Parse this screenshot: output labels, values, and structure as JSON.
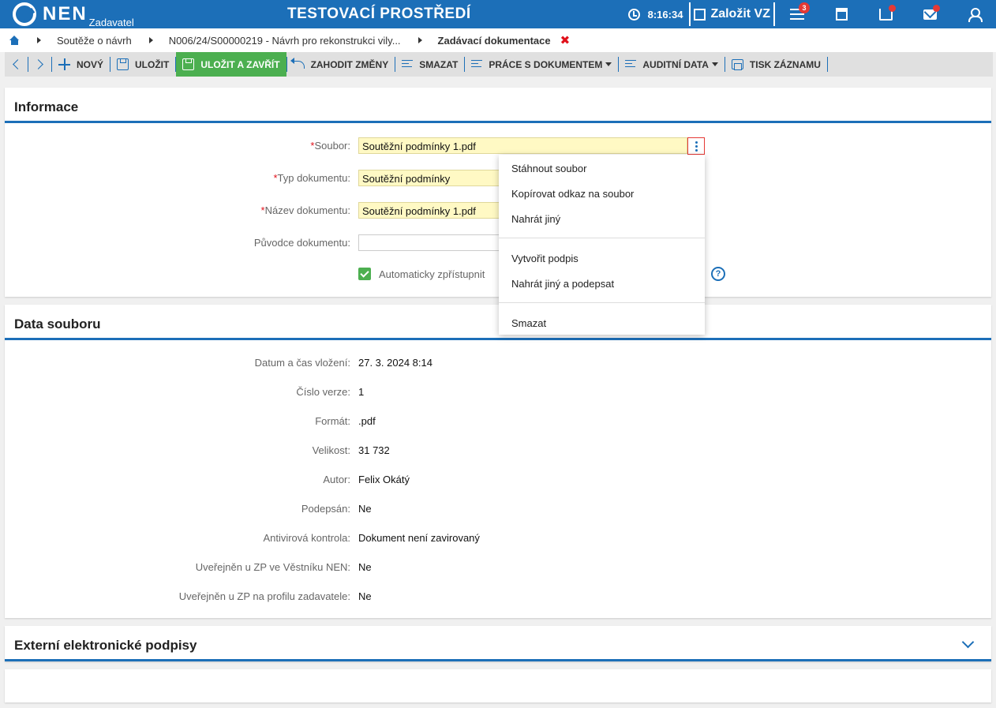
{
  "header": {
    "logo_text": "NEN",
    "logo_sub": "Zadavatel",
    "env_title": "TESTOVACÍ PROSTŘEDÍ",
    "time": "8:16:34",
    "create_label": "Založit VZ",
    "menu_badge": "3"
  },
  "breadcrumb": {
    "items": [
      "Soutěže o návrh",
      "N006/24/S00000219 - Návrh pro rekonstrukci vily..."
    ],
    "current": "Zadávací dokumentace",
    "close": "✖"
  },
  "toolbar": {
    "new": "NOVÝ",
    "save": "ULOŽIT",
    "save_close": "ULOŽIT A ZAVŘÍT",
    "discard": "ZAHODIT ZMĚNY",
    "delete": "SMAZAT",
    "doc_work": "PRÁCE S DOKUMENTEM",
    "audit": "AUDITNÍ DATA",
    "print": "TISK ZÁZNAMU"
  },
  "info": {
    "title": "Informace",
    "required_mark": "*",
    "file_label": "Soubor:",
    "file_value": "Soutěžní podmínky 1.pdf",
    "type_label": "Typ dokumentu:",
    "type_value": "Soutěžní podmínky",
    "name_label": "Název dokumentu:",
    "name_value": "Soutěžní podmínky 1.pdf",
    "author_label": "Původce dokumentu:",
    "author_value": "",
    "auto_label": "Automaticky zpřístupnit",
    "help": "?"
  },
  "context_menu": {
    "items": [
      "Stáhnout soubor",
      "Kopírovat odkaz na soubor",
      "Nahrát jiný",
      "Vytvořit podpis",
      "Nahrát jiný a podepsat",
      "Smazat"
    ]
  },
  "file_data": {
    "title": "Data souboru",
    "rows": [
      {
        "label": "Datum a čas vložení:",
        "value": "27. 3. 2024 8:14"
      },
      {
        "label": "Číslo verze:",
        "value": "1"
      },
      {
        "label": "Formát:",
        "value": ".pdf"
      },
      {
        "label": "Velikost:",
        "value": "31 732"
      },
      {
        "label": "Autor:",
        "value": "Felix Okátý"
      },
      {
        "label": "Podepsán:",
        "value": "Ne"
      },
      {
        "label": "Antivirová kontrola:",
        "value": "Dokument není zavirovaný"
      },
      {
        "label": "Uveřejněn u ZP ve Věstníku NEN:",
        "value": "Ne"
      },
      {
        "label": "Uveřejněn u ZP na profilu zadavatele:",
        "value": "Ne"
      }
    ]
  },
  "signatures": {
    "title": "Externí elektronické podpisy"
  }
}
